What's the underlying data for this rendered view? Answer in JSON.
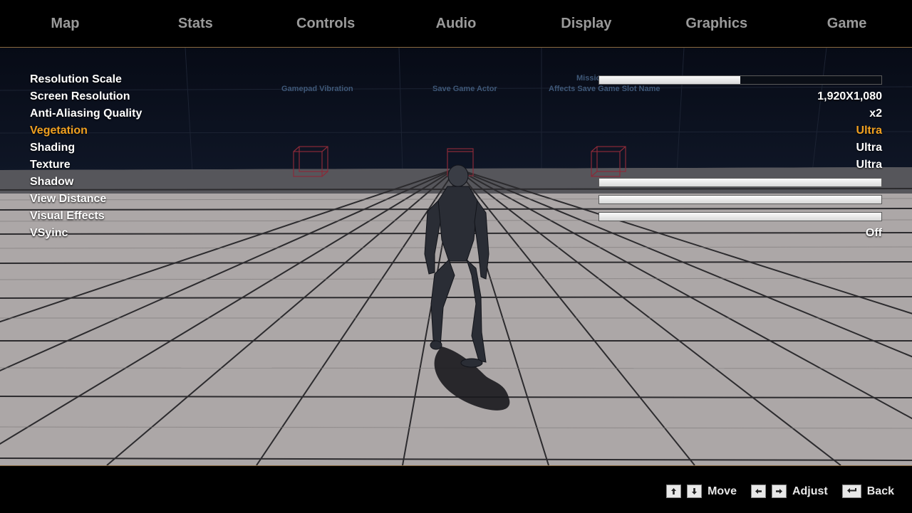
{
  "tabs": [
    {
      "label": "Map"
    },
    {
      "label": "Stats"
    },
    {
      "label": "Controls"
    },
    {
      "label": "Audio"
    },
    {
      "label": "Display"
    },
    {
      "label": "Graphics"
    },
    {
      "label": "Game"
    }
  ],
  "background_text": {
    "gamepad_vibration": "Gamepad Vibration",
    "save_game_actor": "Save Game Actor",
    "mission": "Missio",
    "affects_slot": "Affects Save Game Slot Name"
  },
  "settings": [
    {
      "label": "Resolution Scale",
      "type": "slider",
      "level": 0.5
    },
    {
      "label": "Screen Resolution",
      "type": "value",
      "value": "1,920X1,080"
    },
    {
      "label": "Anti-Aliasing Quality",
      "type": "value",
      "value": "x2"
    },
    {
      "label": "Vegetation",
      "type": "value",
      "value": "Ultra",
      "selected": true
    },
    {
      "label": "Shading",
      "type": "value",
      "value": "Ultra"
    },
    {
      "label": "Texture",
      "type": "value",
      "value": "Ultra"
    },
    {
      "label": "Shadow",
      "type": "slider",
      "level": 1.0
    },
    {
      "label": "View Distance",
      "type": "slider",
      "level": 1.0
    },
    {
      "label": "Visual Effects",
      "type": "slider",
      "level": 1.0
    },
    {
      "label": "VSyinc",
      "type": "value",
      "value": "Off"
    }
  ],
  "hints": {
    "move": "Move",
    "adjust": "Adjust",
    "back": "Back",
    "icons": [
      "arrow-up-key",
      "arrow-down-key",
      "arrow-left-key",
      "arrow-right-key",
      "backspace-key"
    ]
  },
  "colors": {
    "accent": "#f0a020",
    "tab_text": "#9a9a9a",
    "divider": "#8a6a40"
  }
}
